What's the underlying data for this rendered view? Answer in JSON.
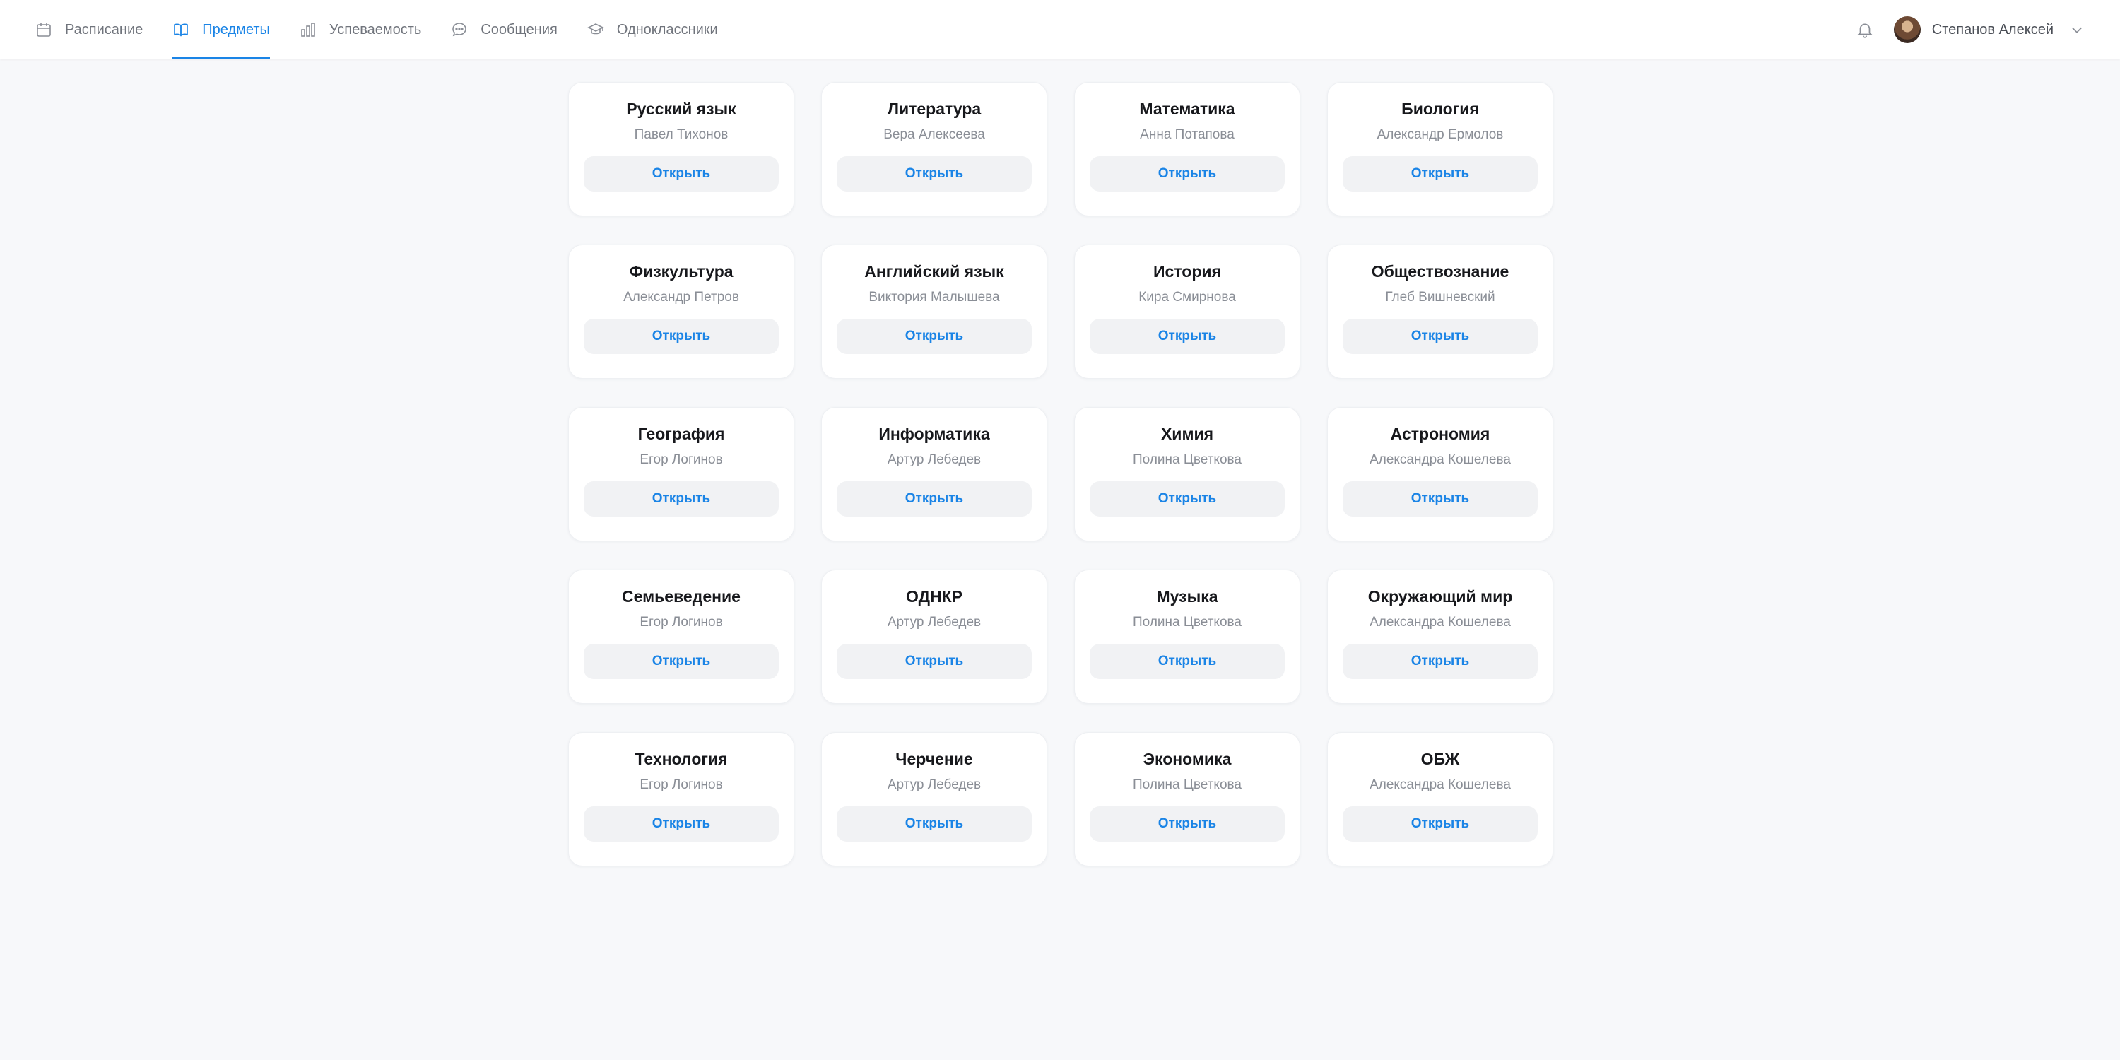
{
  "nav": {
    "items": [
      {
        "label": "Расписание",
        "icon": "calendar-icon",
        "active": false
      },
      {
        "label": "Предметы",
        "icon": "book-icon",
        "active": true
      },
      {
        "label": "Успеваемость",
        "icon": "bar-chart-icon",
        "active": false
      },
      {
        "label": "Сообщения",
        "icon": "chat-icon",
        "active": false
      },
      {
        "label": "Одноклассники",
        "icon": "graduation-cap-icon",
        "active": false
      }
    ]
  },
  "user": {
    "name": "Степанов Алексей",
    "bell_icon": "bell-icon",
    "menu_icon": "chevron-down-icon"
  },
  "colors": {
    "accent": "#1a84e6",
    "background": "#f7f8fa",
    "card": "#ffffff",
    "button_bg": "#f1f2f4",
    "muted_text": "#8a8e96"
  },
  "subjects": [
    {
      "title": "Русский язык",
      "teacher": "Павел Тихонов",
      "action": "Открыть"
    },
    {
      "title": "Литература",
      "teacher": "Вера Алексеева",
      "action": "Открыть"
    },
    {
      "title": "Математика",
      "teacher": "Анна Потапова",
      "action": "Открыть"
    },
    {
      "title": "Биология",
      "teacher": "Александр Ермолов",
      "action": "Открыть"
    },
    {
      "title": "Физкультура",
      "teacher": "Александр Петров",
      "action": "Открыть"
    },
    {
      "title": "Английский язык",
      "teacher": "Виктория Малышева",
      "action": "Открыть"
    },
    {
      "title": "История",
      "teacher": "Кира Смирнова",
      "action": "Открыть"
    },
    {
      "title": "Обществознание",
      "teacher": "Глеб Вишневский",
      "action": "Открыть"
    },
    {
      "title": "География",
      "teacher": "Егор Логинов",
      "action": "Открыть"
    },
    {
      "title": "Информатика",
      "teacher": "Артур Лебедев",
      "action": "Открыть"
    },
    {
      "title": "Химия",
      "teacher": "Полина Цветкова",
      "action": "Открыть"
    },
    {
      "title": "Астрономия",
      "teacher": "Александра Кошелева",
      "action": "Открыть"
    },
    {
      "title": "Семьеведение",
      "teacher": "Егор Логинов",
      "action": "Открыть"
    },
    {
      "title": "ОДНКР",
      "teacher": "Артур Лебедев",
      "action": "Открыть"
    },
    {
      "title": "Музыка",
      "teacher": "Полина Цветкова",
      "action": "Открыть"
    },
    {
      "title": "Окружающий мир",
      "teacher": "Александра Кошелева",
      "action": "Открыть"
    },
    {
      "title": "Технология",
      "teacher": "Егор Логинов",
      "action": "Открыть"
    },
    {
      "title": "Черчение",
      "teacher": "Артур Лебедев",
      "action": "Открыть"
    },
    {
      "title": "Экономика",
      "teacher": "Полина Цветкова",
      "action": "Открыть"
    },
    {
      "title": "ОБЖ",
      "teacher": "Александра Кошелева",
      "action": "Открыть"
    }
  ]
}
